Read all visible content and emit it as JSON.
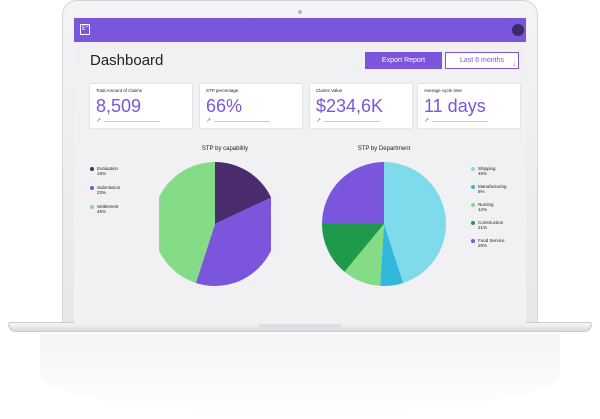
{
  "topbar": {
    "icon": "app-logo-icon",
    "icon_text": "E”",
    "accent": "#7b55dc"
  },
  "page": {
    "title": "Dashboard"
  },
  "actions": {
    "export_label": "Export Report",
    "period_label": "Last 6 months"
  },
  "cards": [
    {
      "label": "Total Amount of Claims",
      "value": "8,509"
    },
    {
      "label": "STP percentage",
      "value": "66%"
    },
    {
      "label": "Claims Value",
      "value": "$234,6K"
    },
    {
      "label": "Average cycle time",
      "value": "11 days"
    }
  ],
  "chart_data": [
    {
      "type": "pie",
      "title": "STP by capability",
      "legend_placement": "left",
      "slices": [
        {
          "label": "Evaluation",
          "value": 18,
          "percent_label": "18%",
          "color": "#4a2c6e"
        },
        {
          "label": "Submission",
          "value": 37,
          "percent_label": "23%",
          "color": "#7b55dc"
        },
        {
          "label": "Settlement",
          "value": 45,
          "percent_label": "45%",
          "color": "#84dd86"
        }
      ]
    },
    {
      "type": "pie",
      "title": "STP by Department",
      "legend_placement": "right",
      "slices": [
        {
          "label": "Shipping",
          "value": 45,
          "percent_label": "45%",
          "color": "#7fdaec"
        },
        {
          "label": "Manufacturing",
          "value": 6,
          "percent_label": "8%",
          "color": "#33b8dc"
        },
        {
          "label": "Nursing",
          "value": 10,
          "percent_label": "12%",
          "color": "#84dd86"
        },
        {
          "label": "Construction",
          "value": 14,
          "percent_label": "21%",
          "color": "#1f9a4b"
        },
        {
          "label": "Food Service",
          "value": 25,
          "percent_label": "25%",
          "color": "#7b55dc"
        }
      ]
    }
  ]
}
